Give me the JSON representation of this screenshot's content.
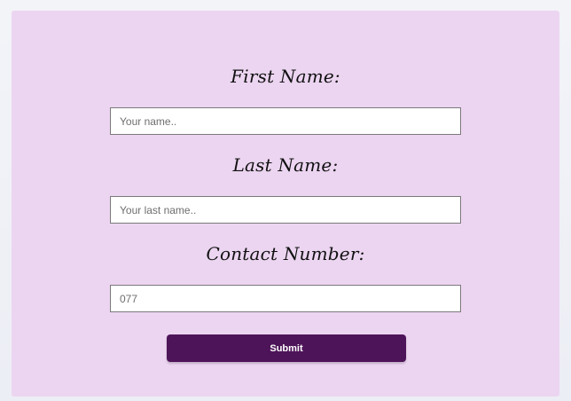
{
  "form": {
    "first_name": {
      "label": "First Name:",
      "value": "",
      "placeholder": "Your name.."
    },
    "last_name": {
      "label": "Last Name:",
      "value": "",
      "placeholder": "Your last name.."
    },
    "contact_number": {
      "label": "Contact Number:",
      "value": "",
      "placeholder": "077"
    },
    "submit_label": "Submit"
  },
  "colors": {
    "card_background": "#ecd5f1",
    "submit_background": "#4e1459",
    "submit_text": "#ffffff",
    "input_border": "#7a7a7a"
  }
}
